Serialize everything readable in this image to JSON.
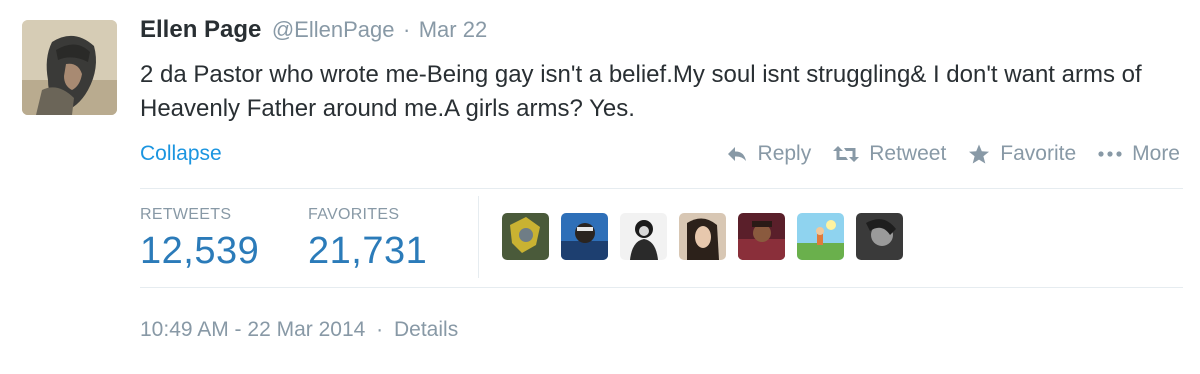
{
  "tweet": {
    "fullname": "Ellen Page",
    "username": "@EllenPage",
    "separator": "·",
    "date": "Mar 22",
    "text": "2 da Pastor who wrote me-Being gay isn't a belief.My soul isnt struggling& I don't want arms of Heavenly Father around me.A girls arms? Yes.",
    "collapse_label": "Collapse"
  },
  "actions": {
    "reply": "Reply",
    "retweet": "Retweet",
    "favorite": "Favorite",
    "more": "More"
  },
  "stats": {
    "retweets_label": "RETWEETS",
    "retweets_value": "12,539",
    "favorites_label": "FAVORITES",
    "favorites_value": "21,731"
  },
  "footer": {
    "timestamp": "10:49 AM - 22 Mar 2014",
    "separator": "·",
    "details": "Details"
  },
  "colors": {
    "link": "#1b95e0",
    "stat_value": "#2b7bb9",
    "muted": "#8899a6",
    "text": "#292f33"
  },
  "icons": {
    "reply": "reply-arrow-icon",
    "retweet": "retweet-icon",
    "favorite": "star-icon",
    "more": "ellipsis-icon"
  }
}
